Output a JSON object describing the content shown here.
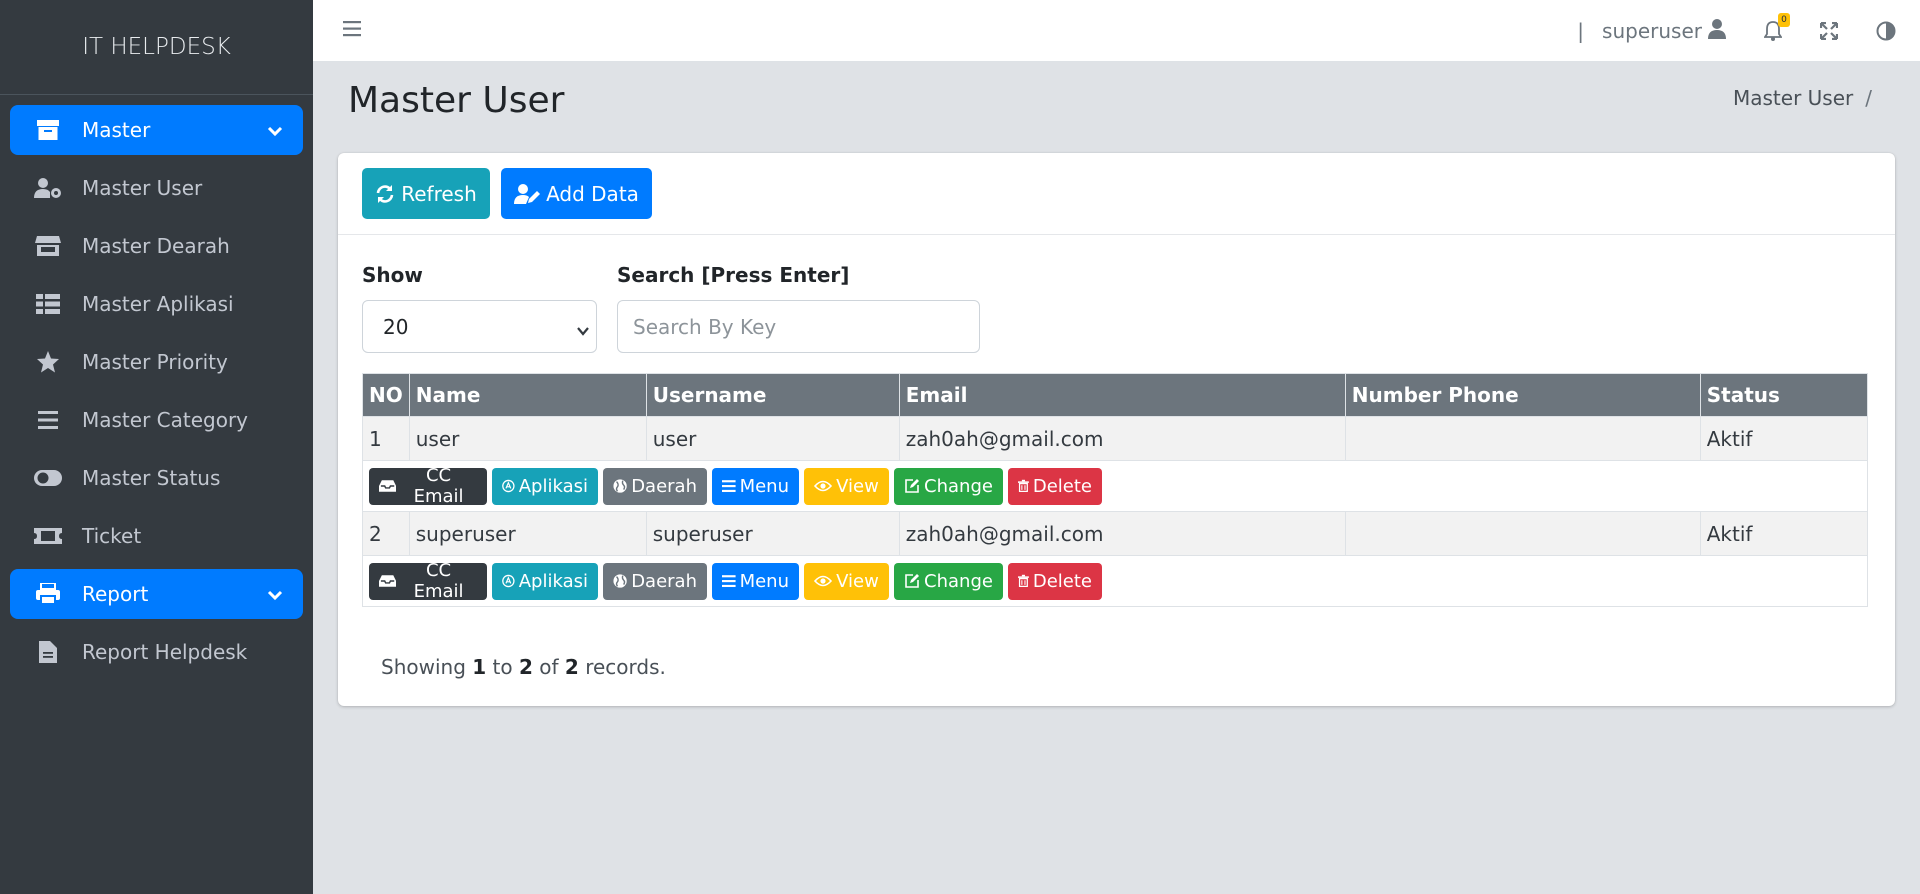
{
  "app": {
    "brand": "IT HELPDESK"
  },
  "sidebar": {
    "items": [
      {
        "label": "Master",
        "icon": "archive-icon",
        "active": true,
        "expandable": true
      },
      {
        "label": "Master User",
        "icon": "users-cog-icon"
      },
      {
        "label": "Master Dearah",
        "icon": "store-icon"
      },
      {
        "label": "Master Aplikasi",
        "icon": "table-icon"
      },
      {
        "label": "Master Priority",
        "icon": "star-icon"
      },
      {
        "label": "Master Category",
        "icon": "bars-icon"
      },
      {
        "label": "Master Status",
        "icon": "toggle-icon"
      },
      {
        "label": "Ticket",
        "icon": "ticket-icon"
      },
      {
        "label": "Report",
        "icon": "print-icon",
        "active": true,
        "expandable": true
      },
      {
        "label": "Report Helpdesk",
        "icon": "file-icon"
      }
    ]
  },
  "topbar": {
    "separator": "|",
    "user": "superuser",
    "notification_count": "0"
  },
  "page": {
    "title": "Master User",
    "breadcrumb": "Master User",
    "breadcrumb_sep": "/"
  },
  "toolbar": {
    "refresh_label": "Refresh",
    "add_label": "Add Data"
  },
  "filters": {
    "show_label": "Show",
    "show_value": "20",
    "search_label": "Search [Press Enter]",
    "search_placeholder": "Search By Key"
  },
  "table": {
    "headers": [
      "NO",
      "Name",
      "Username",
      "Email",
      "Number Phone",
      "Status"
    ],
    "rows": [
      {
        "no": "1",
        "name": "user",
        "username": "user",
        "email": "zah0ah@gmail.com",
        "phone": "",
        "status": "Aktif"
      },
      {
        "no": "2",
        "name": "superuser",
        "username": "superuser",
        "email": "zah0ah@gmail.com",
        "phone": "",
        "status": "Aktif"
      }
    ],
    "actions": [
      "CC Email",
      "Aplikasi",
      "Daerah",
      "Menu",
      "View",
      "Change",
      "Delete"
    ]
  },
  "footer": {
    "prefix": "Showing",
    "from": "1",
    "to_word": "to",
    "to": "2",
    "of_word": "of",
    "total": "2",
    "suffix": "records."
  },
  "colors": {
    "sidebar": "#343a40",
    "primary": "#007bff",
    "info": "#17a2b8",
    "secondary": "#6c757d",
    "warning": "#ffc107",
    "success": "#28a745",
    "danger": "#dc3545",
    "dark": "#343a40"
  }
}
